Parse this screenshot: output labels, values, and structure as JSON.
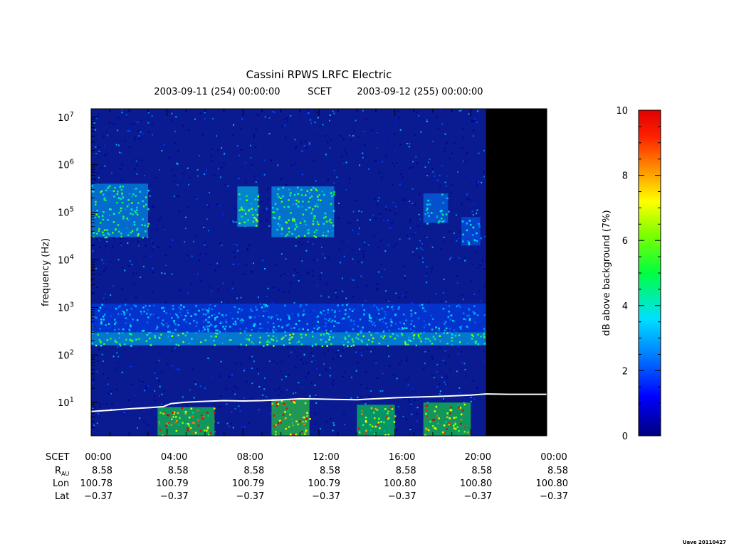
{
  "chart_data": {
    "type": "heatmap",
    "title": "Cassini RPWS LRFC Electric",
    "subtitle": {
      "start": "2003-09-11 (254) 00:00:00",
      "mid": "SCET",
      "end": "2003-09-12 (255) 00:00:00"
    },
    "ylabel": "frequency (Hz)",
    "yscale": "log",
    "ylim": [
      2,
      15000000
    ],
    "y_ticks": [
      {
        "exp": 1,
        "base": "10",
        "sup": "1"
      },
      {
        "exp": 2,
        "base": "10",
        "sup": "2"
      },
      {
        "exp": 3,
        "base": "10",
        "sup": "3"
      },
      {
        "exp": 4,
        "base": "10",
        "sup": "4"
      },
      {
        "exp": 5,
        "base": "10",
        "sup": "5"
      },
      {
        "exp": 6,
        "base": "10",
        "sup": "6"
      },
      {
        "exp": 7,
        "base": "10",
        "sup": "7"
      }
    ],
    "xlim_hours": [
      0,
      24
    ],
    "data_end_hour": 20.8,
    "no_data_color": "#000000",
    "colorbar": {
      "label": "dB above background (7%)",
      "range": [
        0,
        10
      ],
      "ticks": [
        "0",
        "2",
        "4",
        "6",
        "8",
        "10"
      ],
      "colormap": "rainbow"
    },
    "ephemeris": {
      "row_labels": {
        "scet": "SCET",
        "rau": "R",
        "rau_sub": "AU",
        "lon": "Lon",
        "lat": "Lat"
      },
      "columns": [
        {
          "hour": 0,
          "scet": "00:00",
          "rau": "8.58",
          "lon": "100.78",
          "lat": "−0.37"
        },
        {
          "hour": 4,
          "scet": "04:00",
          "rau": "8.58",
          "lon": "100.79",
          "lat": "−0.37"
        },
        {
          "hour": 8,
          "scet": "08:00",
          "rau": "8.58",
          "lon": "100.79",
          "lat": "−0.37"
        },
        {
          "hour": 12,
          "scet": "12:00",
          "rau": "8.58",
          "lon": "100.79",
          "lat": "−0.37"
        },
        {
          "hour": 16,
          "scet": "16:00",
          "rau": "8.58",
          "lon": "100.80",
          "lat": "−0.37"
        },
        {
          "hour": 20,
          "scet": "20:00",
          "rau": "8.58",
          "lon": "100.80",
          "lat": "−0.37"
        },
        {
          "hour": 24,
          "scet": "00:00",
          "rau": "8.58",
          "lon": "100.80",
          "lat": "−0.37"
        }
      ]
    },
    "overlay_line": {
      "color": "#ffffff",
      "points": [
        {
          "h": 0.0,
          "f": 6.5
        },
        {
          "h": 1.0,
          "f": 6.9
        },
        {
          "h": 2.0,
          "f": 7.4
        },
        {
          "h": 3.0,
          "f": 7.8
        },
        {
          "h": 3.8,
          "f": 8.2
        },
        {
          "h": 4.2,
          "f": 9.5
        },
        {
          "h": 5.0,
          "f": 10.2
        },
        {
          "h": 6.0,
          "f": 10.6
        },
        {
          "h": 7.0,
          "f": 11.0
        },
        {
          "h": 8.0,
          "f": 10.8
        },
        {
          "h": 9.0,
          "f": 11.0
        },
        {
          "h": 10.0,
          "f": 11.4
        },
        {
          "h": 11.0,
          "f": 12.0
        },
        {
          "h": 12.0,
          "f": 11.9
        },
        {
          "h": 13.0,
          "f": 11.6
        },
        {
          "h": 14.0,
          "f": 11.5
        },
        {
          "h": 15.0,
          "f": 12.0
        },
        {
          "h": 16.0,
          "f": 12.6
        },
        {
          "h": 17.0,
          "f": 13.0
        },
        {
          "h": 18.0,
          "f": 13.3
        },
        {
          "h": 19.0,
          "f": 13.8
        },
        {
          "h": 20.0,
          "f": 14.3
        },
        {
          "h": 20.8,
          "f": 15.2
        },
        {
          "h": 22.0,
          "f": 14.9
        },
        {
          "h": 24.0,
          "f": 14.9
        }
      ]
    },
    "features": [
      {
        "name": "emission-patch",
        "h0": 0.0,
        "h1": 3.0,
        "f0": 30000,
        "f1": 400000,
        "level": 5.5
      },
      {
        "name": "emission-patch",
        "h0": 7.7,
        "h1": 8.8,
        "f0": 50000,
        "f1": 350000,
        "level": 6.5
      },
      {
        "name": "emission-patch",
        "h0": 9.5,
        "h1": 12.8,
        "f0": 30000,
        "f1": 350000,
        "level": 5.8
      },
      {
        "name": "emission-patch",
        "h0": 17.5,
        "h1": 18.8,
        "f0": 60000,
        "f1": 250000,
        "level": 4.5
      },
      {
        "name": "emission-patch",
        "h0": 19.5,
        "h1": 20.5,
        "f0": 20000,
        "f1": 80000,
        "level": 4.0
      },
      {
        "name": "band",
        "h0": 0.0,
        "h1": 20.8,
        "f0": 300,
        "f1": 1200,
        "level": 3.5
      },
      {
        "name": "band",
        "h0": 0.0,
        "h1": 20.8,
        "f0": 160,
        "f1": 300,
        "level": 6.0
      },
      {
        "name": "low-freq-burst",
        "h0": 3.5,
        "h1": 6.5,
        "f0": 2,
        "f1": 8,
        "level": 9.5
      },
      {
        "name": "low-freq-burst",
        "h0": 9.5,
        "h1": 11.5,
        "f0": 2,
        "f1": 12,
        "level": 10
      },
      {
        "name": "low-freq-burst",
        "h0": 14.0,
        "h1": 16.0,
        "f0": 2,
        "f1": 9,
        "level": 9.0
      },
      {
        "name": "low-freq-burst",
        "h0": 17.5,
        "h1": 20.0,
        "f0": 2,
        "f1": 10,
        "level": 9.5
      }
    ]
  },
  "footer": {
    "version": "Uave 20110427"
  }
}
